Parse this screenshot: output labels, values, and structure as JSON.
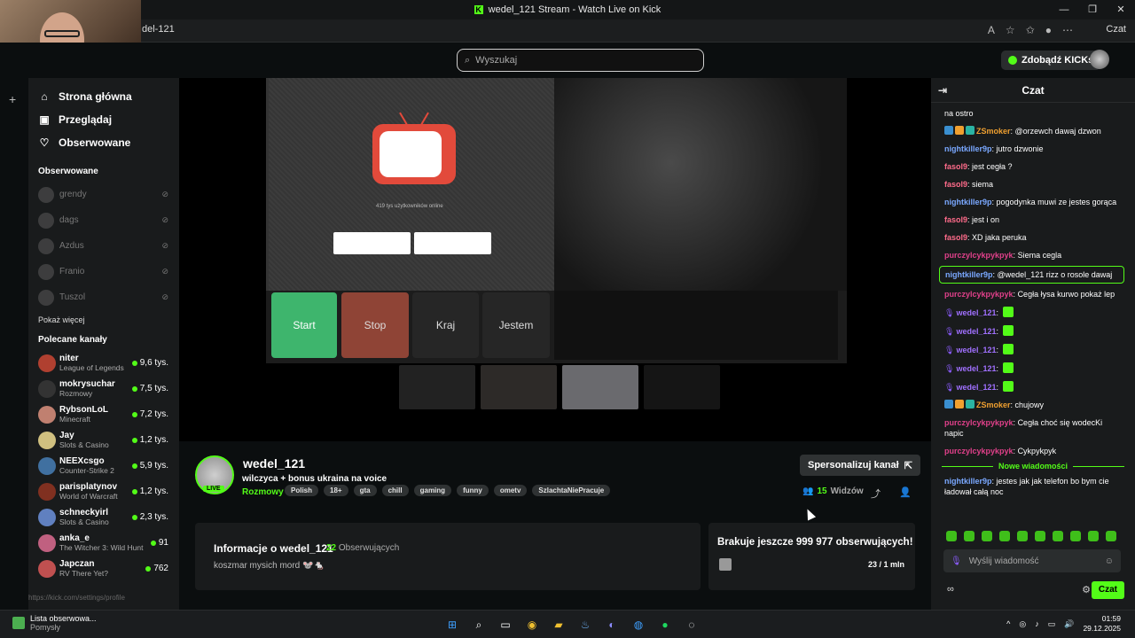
{
  "window": {
    "title": "wedel_121 Stream - Watch Live on Kick",
    "controls": [
      "—",
      "❐",
      "✕"
    ]
  },
  "browser": {
    "url": "del-121",
    "profile_label": "Czat"
  },
  "topbar": {
    "search_placeholder": "Wyszukaj",
    "kicks_label": "Zdobądź KICKs"
  },
  "sidebar": {
    "nav": [
      {
        "label": "Strona główna",
        "icon": "home-icon",
        "glyph": "⌂"
      },
      {
        "label": "Przeglądaj",
        "icon": "browse-icon",
        "glyph": "▣"
      },
      {
        "label": "Obserwowane",
        "icon": "heart-icon",
        "glyph": "♡"
      }
    ],
    "followed_title": "Obserwowane",
    "followed": [
      {
        "name": "grendy"
      },
      {
        "name": "dags"
      },
      {
        "name": "Azdus"
      },
      {
        "name": "Franio"
      },
      {
        "name": "Tuszol"
      }
    ],
    "show_more": "Pokaż więcej",
    "recommended_title": "Polecane kanały",
    "recommended": [
      {
        "name": "niter",
        "game": "League of Legends",
        "viewers": "9,6 tys.",
        "color": "#b04030"
      },
      {
        "name": "mokrysuchar",
        "game": "Rozmowy",
        "viewers": "7,5 tys.",
        "color": "#333333"
      },
      {
        "name": "RybsonLoL",
        "game": "Minecraft",
        "viewers": "7,2 tys.",
        "color": "#c08070"
      },
      {
        "name": "Jay",
        "game": "Slots & Casino",
        "viewers": "1,2 tys.",
        "color": "#d0c080"
      },
      {
        "name": "NEEXcsgo",
        "game": "Counter-Strike 2",
        "viewers": "5,9 tys.",
        "color": "#4070a0"
      },
      {
        "name": "parisplatynov",
        "game": "World of Warcraft",
        "viewers": "1,2 tys.",
        "color": "#803020"
      },
      {
        "name": "schneckyirl",
        "game": "Slots & Casino",
        "viewers": "2,3 tys.",
        "color": "#6080c0"
      },
      {
        "name": "anka_e",
        "game": "The Witcher 3: Wild Hunt",
        "viewers": "91",
        "color": "#c06080"
      },
      {
        "name": "Japczan",
        "game": "RV There Yet?",
        "viewers": "762",
        "color": "#c05050"
      }
    ]
  },
  "video": {
    "online_text": "419 tys użytkowników online",
    "buttons": [
      "Start",
      "Stop",
      "Kraj",
      "Jestem"
    ]
  },
  "channel": {
    "name": "wedel_121",
    "live": "LIVE",
    "title": "wilczyca + bonus ukraina na voice",
    "category": "Rozmowy",
    "tags": [
      "Polish",
      "18+",
      "gta",
      "chill",
      "gaming",
      "funny",
      "ometv",
      "SzlachtaNiePracuje"
    ],
    "personalize": "Spersonalizuj kanał",
    "viewers_count": "15",
    "viewers_label": "Widzów",
    "info_title": "Informacje o wedel_121",
    "followers_count": "22",
    "followers_label": "Obserwujących",
    "bio": "koszmar mysich mord 🐭🐁",
    "goal_title": "Brakuje jeszcze 999 977 obserwujących!",
    "goal_count": "23 / 1 mln"
  },
  "chat": {
    "title": "Czat",
    "messages": [
      {
        "user": "",
        "text": "na ostro",
        "color": "#ffffff"
      },
      {
        "user": "ZSmoker",
        "text": "@orzewch dawaj dzwon",
        "color": "#f0a030",
        "badges": true
      },
      {
        "user": "nightkiller9p",
        "text": "jutro dzwonie",
        "color": "#7aa8ff"
      },
      {
        "user": "fasol9",
        "text": "jest cegła ?",
        "color": "#ff6b8a"
      },
      {
        "user": "fasol9",
        "text": "siema",
        "color": "#ff6b8a"
      },
      {
        "user": "nightkiller9p",
        "text": "pogodynka muwi ze jestes gorąca",
        "color": "#7aa8ff"
      },
      {
        "user": "fasol9",
        "text": "jest i on",
        "color": "#ff6b8a"
      },
      {
        "user": "fasol9",
        "text": "XD jaka peruka",
        "color": "#ff6b8a"
      },
      {
        "user": "purczylcykpykpyk",
        "text": "Siema cegla",
        "color": "#e0408a"
      },
      {
        "user": "nightkiller9p",
        "text": "@wedel_121 rizz o rosole dawaj",
        "color": "#7aa8ff",
        "highlight": true
      },
      {
        "user": "purczylcykpykpyk",
        "text": "Cegła łysa kurwo pokaż lep",
        "color": "#e0408a"
      },
      {
        "user": "wedel_121",
        "text": "",
        "color": "#a070ff",
        "emote": true
      },
      {
        "user": "wedel_121",
        "text": "",
        "color": "#a070ff",
        "emote": true
      },
      {
        "user": "wedel_121",
        "text": "",
        "color": "#a070ff",
        "emote": true
      },
      {
        "user": "wedel_121",
        "text": "",
        "color": "#a070ff",
        "emote": true
      },
      {
        "user": "wedel_121",
        "text": "",
        "color": "#a070ff",
        "emote": true
      },
      {
        "user": "ZSmoker",
        "text": "chujowy",
        "color": "#f0a030",
        "badges": true
      },
      {
        "user": "purczylcykpykpyk",
        "text": "Cegła choć się wodecKi napic",
        "color": "#e0408a"
      },
      {
        "user": "purczylcykpykpyk",
        "text": "Cykpykpyk",
        "color": "#e0408a"
      }
    ],
    "new_messages_label": "Nowe wiadomości",
    "new_messages": [
      {
        "user": "nightkiller9p",
        "text": "jestes jak jak telefon bo bym cie ładował całą noc",
        "color": "#7aa8ff"
      }
    ],
    "input_placeholder": "Wyślij wiadomość",
    "send_label": "Czat"
  },
  "taskbar": {
    "app_title": "Lista obserwowa...",
    "app_subtitle": "Pomysły",
    "time": "01:59",
    "date": "29.12.2025"
  },
  "status_url": "https://kick.com/settings/profile"
}
